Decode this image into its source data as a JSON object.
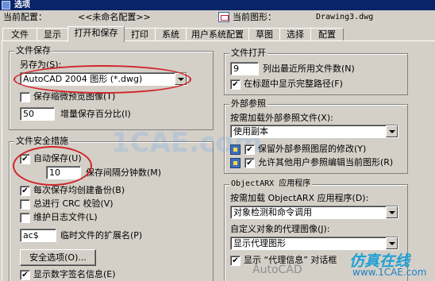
{
  "window": {
    "title": "选项"
  },
  "header": {
    "current_profile_label": "当前配置：",
    "current_profile_value": "<<未命名配置>>",
    "current_drawing_label": "当前图形：",
    "current_drawing_value": "Drawing3.dwg"
  },
  "tabs": [
    {
      "label": "文件"
    },
    {
      "label": "显示"
    },
    {
      "label": "打开和保存"
    },
    {
      "label": "打印"
    },
    {
      "label": "系统"
    },
    {
      "label": "用户系统配置"
    },
    {
      "label": "草图"
    },
    {
      "label": "选择"
    },
    {
      "label": "配置"
    }
  ],
  "file_save": {
    "title": "文件保存",
    "save_as_label": "另存为(S):",
    "save_as_value": "AutoCAD 2004 图形 (*.dwg)",
    "thumbnail_label": "保存缩微预览图像(T)",
    "thumbnail_checked": "",
    "incremental_value": "50",
    "incremental_label": "增量保存百分比(I)"
  },
  "file_safety": {
    "title": "文件安全措施",
    "autosave_label": "自动保存(U)",
    "autosave_checked": "✔",
    "interval_value": "10",
    "interval_label": "保存间隔分钟数(M)",
    "backup_label": "每次保存均创建备份(B)",
    "backup_checked": "✔",
    "crc_label": "总进行 CRC 校验(V)",
    "crc_checked": "",
    "log_label": "维护日志文件(L)",
    "log_checked": "",
    "temp_ext_value": "ac$",
    "temp_ext_label": "临时文件的扩展名(P)",
    "security_button": "安全选项(O)...",
    "signature_label": "显示数字签名信息(E)",
    "signature_checked": "✔"
  },
  "file_open": {
    "title": "文件打开",
    "recent_value": "9",
    "recent_label": "列出最近所用文件数(N)",
    "fullpath_label": "在标题中显示完整路径(F)",
    "fullpath_checked": "✔"
  },
  "xref": {
    "title": "外部参照",
    "demand_load_label": "按需加载外部参照文件(X):",
    "demand_load_value": "使用副本",
    "retain_label": "保留外部参照图层的修改(Y)",
    "retain_checked": "✔",
    "allow_edit_label": "允许其他用户参照编辑当前图形(R)",
    "allow_edit_checked": "✔"
  },
  "objectarx": {
    "title": "ObjectARX 应用程序",
    "demand_load_label": "按需加载 ObjectARX 应用程序(D):",
    "demand_load_value": "对象检测和命令调用",
    "proxy_label": "自定义对象的代理图像(J):",
    "proxy_value": "显示代理图形",
    "proxy_info_label": "显示 “代理信息” 对话框",
    "proxy_info_checked": "✔"
  },
  "watermarks": {
    "center": "1CAE.com",
    "brand_cn": "仿真在线",
    "brand_url": "www.1CAE.com",
    "autocad": "AutoCAD"
  },
  "colors": {
    "highlight_ellipse": "#d1262b",
    "title_bar": "#0a246a"
  }
}
